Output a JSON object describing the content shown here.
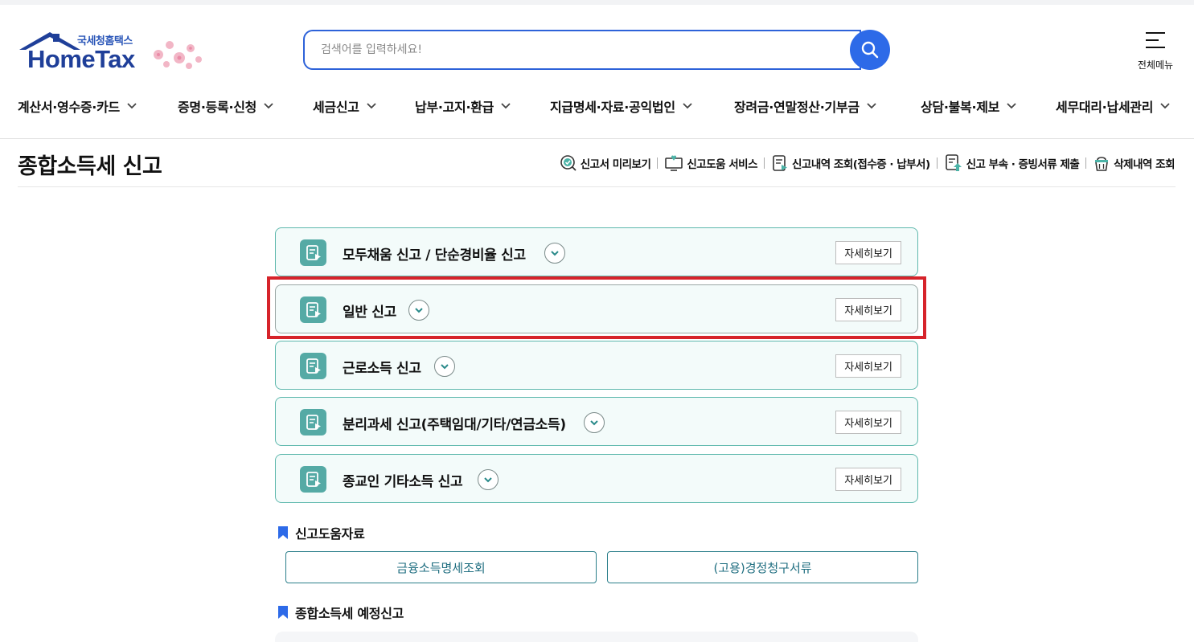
{
  "header": {
    "logo_sub": "국세청홈택스",
    "logo_main": "HomeTax",
    "search_placeholder": "검색어를 입력하세요!",
    "search_value": "",
    "allmenu_label": "전체메뉴"
  },
  "gnb": {
    "items": [
      {
        "label": "계산서·영수증·카드"
      },
      {
        "label": "증명·등록·신청"
      },
      {
        "label": "세금신고"
      },
      {
        "label": "납부·고지·환급"
      },
      {
        "label": "지급명세·자료·공익법인"
      },
      {
        "label": "장려금·연말정산·기부금"
      },
      {
        "label": "상담·불복·제보"
      },
      {
        "label": "세무대리·납세관리"
      }
    ]
  },
  "page": {
    "title": "종합소득세 신고",
    "quick_links": [
      {
        "label": "신고서 미리보기",
        "icon": "preview-check-icon"
      },
      {
        "label": "신고도움 서비스",
        "icon": "help-monitor-icon"
      },
      {
        "label": "신고내역 조회(접수증 · 납부서)",
        "icon": "document-search-icon"
      },
      {
        "label": "신고 부속 · 증빙서류 제출",
        "icon": "document-upload-icon"
      },
      {
        "label": "삭제내역 조회",
        "icon": "trash-basket-icon"
      }
    ]
  },
  "cards": [
    {
      "title": "모두채움 신고 / 단순경비율 신고",
      "detail": "자세히보기"
    },
    {
      "title": "일반 신고",
      "detail": "자세히보기"
    },
    {
      "title": "근로소득 신고",
      "detail": "자세히보기"
    },
    {
      "title": "분리과세 신고(주택임대/기타/연금소득)",
      "detail": "자세히보기"
    },
    {
      "title": "종교인 기타소득 신고",
      "detail": "자세히보기"
    }
  ],
  "help_section": {
    "title": "신고도움자료",
    "buttons": [
      "금융소득명세조회",
      "(고용)경정청구서류"
    ]
  },
  "estimate_section": {
    "title": "종합소득세 예정신고"
  },
  "colors": {
    "brand_blue": "#2d62d9",
    "card_border": "#5eb8ad",
    "card_bg": "#f3fbfa",
    "icon_teal": "#55aaa5",
    "highlight_red": "#d6232a",
    "bookmark_blue": "#2d6ae8"
  }
}
